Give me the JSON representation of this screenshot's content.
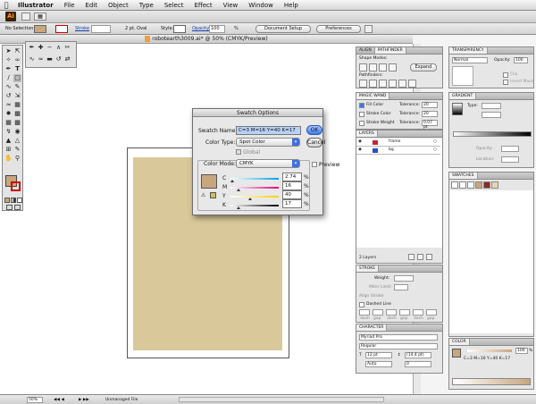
{
  "menubar": {
    "app": "Illustrator",
    "items": [
      "File",
      "Edit",
      "Object",
      "Type",
      "Select",
      "Effect",
      "View",
      "Window",
      "Help"
    ]
  },
  "control": {
    "selection": "No Selection",
    "stroke_label": "Stroke",
    "stroke_weight": "2 pt. Oval",
    "style_label": "Style:",
    "opacity_label": "Opacity:",
    "opacity_value": "100",
    "opacity_unit": "%",
    "doc_setup": "Document Setup",
    "preferences": "Preferences"
  },
  "document": {
    "title": "robotearth3009.ai* @ 50% (CMYK/Preview)",
    "zoom": "50%",
    "status": "Unmanaged File"
  },
  "colors": {
    "art_fill": "#d9c99a",
    "swatch_fill": "#c8a67e",
    "accent": "#3d7ae8"
  },
  "dialog": {
    "title": "Swatch Options",
    "swatch_name_label": "Swatch Name:",
    "swatch_name": "C=3 M=16 Y=40 K=17",
    "color_type_label": "Color Type:",
    "color_type": "Spot Color",
    "global_label": "Global",
    "color_mode_label": "Color Mode:",
    "color_mode": "CMYK",
    "preview_label": "Preview",
    "ok": "OK",
    "cancel": "Cancel",
    "channels": [
      {
        "name": "C",
        "value": "2.74",
        "fraction": 0.03
      },
      {
        "name": "M",
        "value": "16",
        "fraction": 0.16
      },
      {
        "name": "Y",
        "value": "40",
        "fraction": 0.4
      },
      {
        "name": "K",
        "value": "17",
        "fraction": 0.17
      }
    ],
    "unit": "%"
  },
  "align_panel": {
    "tabs": [
      "ALIGN",
      "PATHFINDER"
    ],
    "shape_modes": "Shape Modes:",
    "expand": "Expand",
    "pathfinders": "Pathfinders:"
  },
  "transparency": {
    "tab": "TRANSPARENCY",
    "mode": "Normal",
    "opacity_label": "Opacity:",
    "opacity": "100",
    "clip": "Clip",
    "invert": "Invert Mask"
  },
  "magic_wand": {
    "tab": "MAGIC WAND",
    "fill_color": "Fill Color",
    "stroke_color": "Stroke Color",
    "stroke_weight": "Stroke Weight",
    "tolerance": "Tolerance:",
    "tol1": "20",
    "tol2": "20",
    "tol3": "0.07 pt"
  },
  "gradient": {
    "tab": "GRADIENT",
    "type_label": "Type:",
    "opacity_label": "Opacity:",
    "location_label": "Location:"
  },
  "layers": {
    "tab": "LAYERS",
    "rows": [
      "frame",
      "bg"
    ],
    "footer": "2 Layers"
  },
  "swatches": {
    "tab": "SWATCHES"
  },
  "stroke": {
    "tab": "STROKE",
    "weight_label": "Weight:",
    "miter_label": "Miter Limit:",
    "align_label": "Align Stroke:",
    "dashed": "Dashed Line",
    "dash_labels": [
      "dash",
      "gap",
      "dash",
      "gap",
      "dash",
      "gap"
    ]
  },
  "character": {
    "tab": "CHARACTER",
    "font": "Myriad Pro",
    "style": "Regular",
    "size": "12 pt",
    "leading": "(14.4 pt)",
    "tracking": "Auto",
    "kerning": "0"
  },
  "color_panel": {
    "tab": "COLOR",
    "readout": "C=3 M=16 Y=40 K=17",
    "value": "100",
    "unit": "%"
  }
}
